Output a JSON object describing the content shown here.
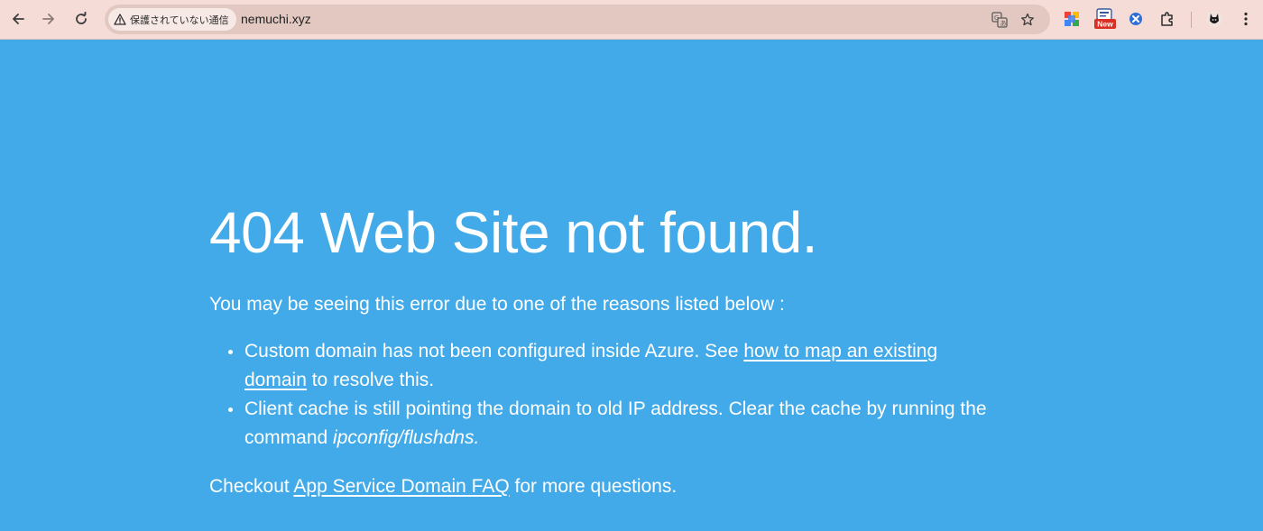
{
  "browser": {
    "security_label": "保護されていない通信",
    "url": "nemuchi.xyz",
    "ext_badge_label": "New"
  },
  "page": {
    "title": "404 Web Site not found.",
    "intro": "You may be seeing this error due to one of the reasons listed below :",
    "reasons": [
      {
        "text_before": "Custom domain has not been configured inside Azure. See ",
        "link_text_1": "how to map an existing",
        "link_text_2": "domain",
        "text_after": " to resolve this."
      },
      {
        "text_before": "Client cache is still pointing the domain to old IP address. Clear the cache by running the command ",
        "command": "ipconfig/flushdns."
      }
    ],
    "checkout_before": "Checkout ",
    "checkout_link": "App Service Domain FAQ",
    "checkout_after": " for more questions."
  },
  "colors": {
    "page_background": "#42aae9",
    "toolbar_background": "#f5dcd6",
    "omnibox_background": "#e2c8c1",
    "text": "#ffffff"
  }
}
